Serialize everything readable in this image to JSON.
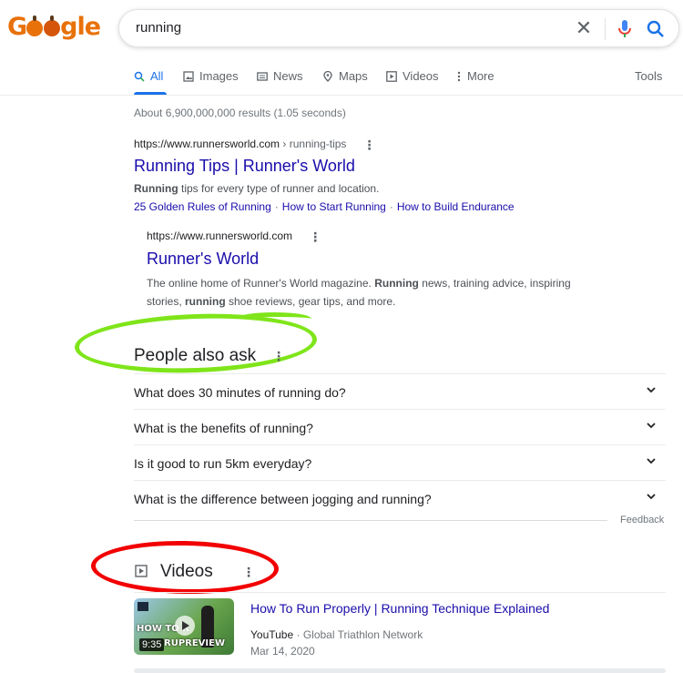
{
  "logo": {
    "text": "Google"
  },
  "search": {
    "query": "running"
  },
  "tabs": [
    {
      "label": "All",
      "icon": "search-icon",
      "active": true
    },
    {
      "label": "Images",
      "icon": "image-icon"
    },
    {
      "label": "News",
      "icon": "newspaper-icon"
    },
    {
      "label": "Maps",
      "icon": "map-pin-icon"
    },
    {
      "label": "Videos",
      "icon": "video-play-icon"
    },
    {
      "label": "More",
      "icon": "more-vert-icon"
    }
  ],
  "tools_label": "Tools",
  "stats": "About 6,900,000,000 results (1.05 seconds)",
  "result1": {
    "url": "https://www.runnersworld.com",
    "path": " › running-tips",
    "title": "Running Tips | Runner's World",
    "snippet_bold": "Running",
    "snippet_rest": " tips for every type of runner and location.",
    "sitelinks": [
      "25 Golden Rules of Running",
      "How to Start Running",
      "How to Build Endurance"
    ]
  },
  "result2": {
    "url": "https://www.runnersworld.com",
    "title": "Runner's World",
    "s1": "The online home of Runner's World magazine. ",
    "s2": "Running",
    "s3": " news, training advice, inspiring stories, ",
    "s4": "running",
    "s5": " shoe reviews, gear tips, and more."
  },
  "paa": {
    "title": "People also ask",
    "questions": [
      "What does 30 minutes of running do?",
      "What is the benefits of running?",
      "Is it good to run 5km everyday?",
      "What is the difference between jogging and running?"
    ],
    "feedback": "Feedback"
  },
  "videos": {
    "title": "Videos",
    "items": [
      {
        "title": "How To Run Properly | Running Technique Explained",
        "source": "YouTube",
        "channel": "Global Triathlon Network",
        "date": "Mar 14, 2020",
        "duration": "9:35",
        "thumb_text_1": "HOW TO R",
        "thumb_text_2": "RUPREVIEW"
      }
    ]
  },
  "colors": {
    "link": "#1a0dab",
    "accent": "#1a73e8",
    "annotation_green": "#7fe51a",
    "annotation_red": "#f20000"
  }
}
